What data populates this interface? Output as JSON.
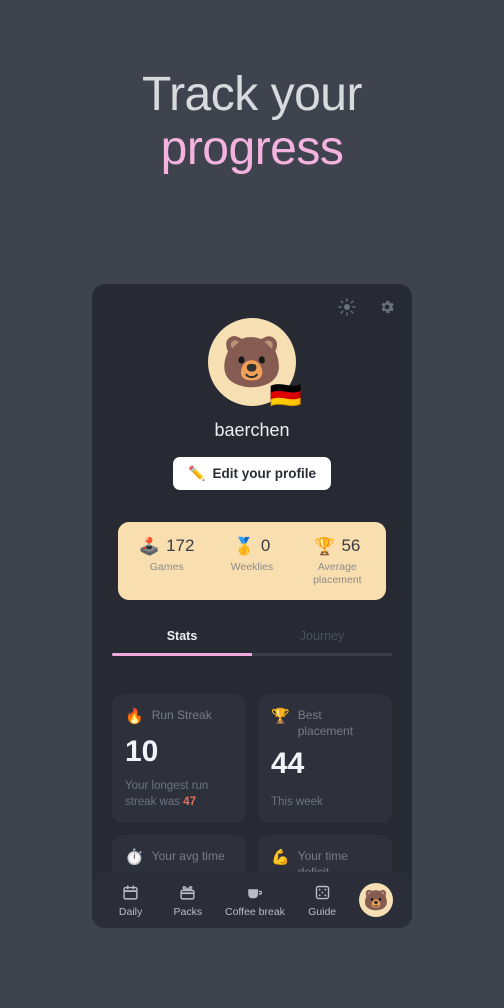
{
  "headline": {
    "line1": "Track your",
    "line2": "progress",
    "line1_color": "#d9dade",
    "line2_color": "#f4b3df"
  },
  "colors": {
    "page_background": "#3f434e",
    "card_background": "#272a33",
    "stat_card_background": "#2e313c",
    "accent_peach": "#f9dfb0",
    "accent_pink": "#f0a8e0",
    "highlight_orange": "#e8715a"
  },
  "app": {
    "top_icons": [
      {
        "name": "theme-toggle",
        "icon": "sun-icon"
      },
      {
        "name": "settings",
        "icon": "gear-icon"
      }
    ],
    "profile": {
      "avatar_emoji": "🐻",
      "flag_emoji": "🇩🇪",
      "username": "baerchen",
      "edit_button": {
        "emoji": "✏️",
        "label": "Edit your profile"
      }
    },
    "summary_strip": [
      {
        "icon": "joystick-icon",
        "emoji": "🕹️",
        "value": "172",
        "label": "Games"
      },
      {
        "icon": "medal-icon",
        "emoji": "🥇",
        "value": "0",
        "label": "Weeklies"
      },
      {
        "icon": "trophy-icon",
        "emoji": "🏆",
        "value": "56",
        "label": "Average placement"
      }
    ],
    "tabs": [
      {
        "label": "Stats",
        "active": true
      },
      {
        "label": "Journey",
        "active": false
      }
    ],
    "stat_cards": [
      {
        "emoji": "🔥",
        "icon": "fire-icon",
        "title": "Run Streak",
        "value": "10",
        "footer_prefix": "Your longest run streak was ",
        "footer_highlight": "47",
        "footer_suffix": ""
      },
      {
        "emoji": "🏆",
        "icon": "trophy-icon",
        "title": "Best placement",
        "value": "44",
        "footer_prefix": "This week",
        "footer_highlight": "",
        "footer_suffix": ""
      },
      {
        "emoji": "⏱️",
        "icon": "stopwatch-icon",
        "title": "Your avg time",
        "value": "",
        "footer_prefix": "",
        "footer_highlight": "",
        "footer_suffix": ""
      },
      {
        "emoji": "💪",
        "icon": "flexed-biceps-icon",
        "title": "Your time deficit",
        "value": "",
        "footer_prefix": "",
        "footer_highlight": "",
        "footer_suffix": ""
      }
    ],
    "bottom_nav": [
      {
        "label": "Daily",
        "icon": "calendar-icon"
      },
      {
        "label": "Packs",
        "icon": "gift-box-icon"
      },
      {
        "label": "Coffee break",
        "icon": "coffee-cup-icon"
      },
      {
        "label": "Guide",
        "icon": "dice-icon"
      }
    ],
    "bottom_nav_avatar": {
      "emoji": "🐻",
      "icon": "bear-avatar-icon"
    }
  }
}
